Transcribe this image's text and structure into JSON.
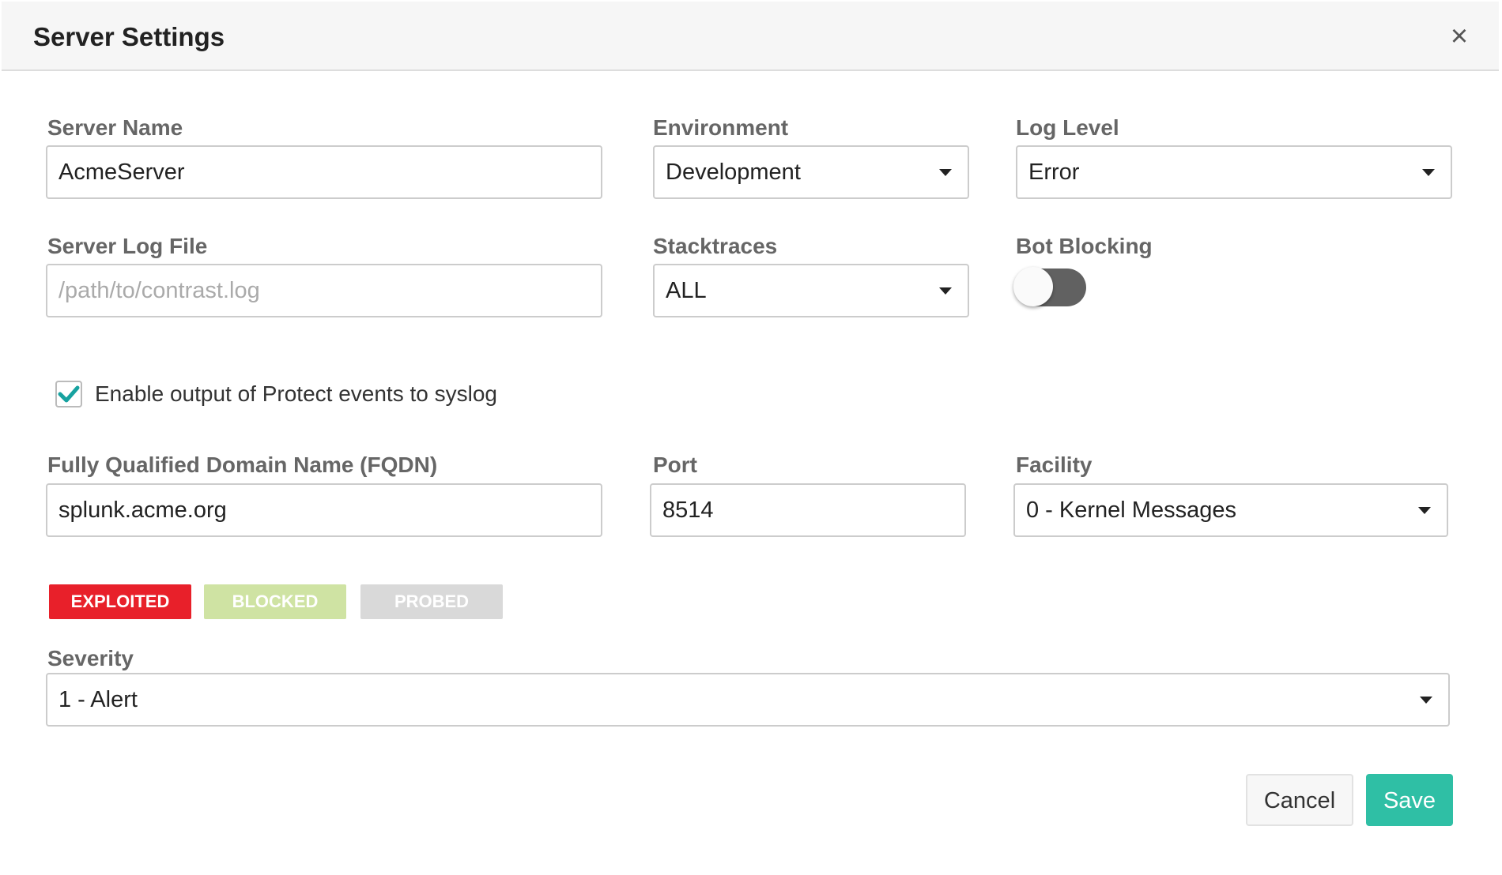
{
  "dialog": {
    "title": "Server Settings",
    "close_label": "×"
  },
  "server_name": {
    "label": "Server Name",
    "value": "AcmeServer"
  },
  "environment": {
    "label": "Environment",
    "value": "Development"
  },
  "log_level": {
    "label": "Log Level",
    "value": "Error"
  },
  "server_log_file": {
    "label": "Server Log File",
    "placeholder": "/path/to/contrast.log",
    "value": ""
  },
  "stacktraces": {
    "label": "Stacktraces",
    "value": "ALL"
  },
  "bot_blocking": {
    "label": "Bot Blocking",
    "enabled": false
  },
  "syslog": {
    "label": "Enable output of Protect events to syslog",
    "checked": true
  },
  "fqdn": {
    "label": "Fully Qualified Domain Name (FQDN)",
    "value": "splunk.acme.org"
  },
  "port": {
    "label": "Port",
    "value": "8514"
  },
  "facility": {
    "label": "Facility",
    "value": "0 - Kernel Messages"
  },
  "tags": [
    {
      "label": "EXPLOITED",
      "color": "#e8202a",
      "active": true
    },
    {
      "label": "BLOCKED",
      "color": "#cfe3a3",
      "active": false
    },
    {
      "label": "PROBED",
      "color": "#d9d9d9",
      "active": false
    }
  ],
  "severity": {
    "label": "Severity",
    "value": "1 - Alert"
  },
  "buttons": {
    "cancel": "Cancel",
    "save": "Save"
  },
  "colors": {
    "accent": "#2fbfa5",
    "checkmark": "#17a2a0",
    "toggle_track": "#616161"
  }
}
